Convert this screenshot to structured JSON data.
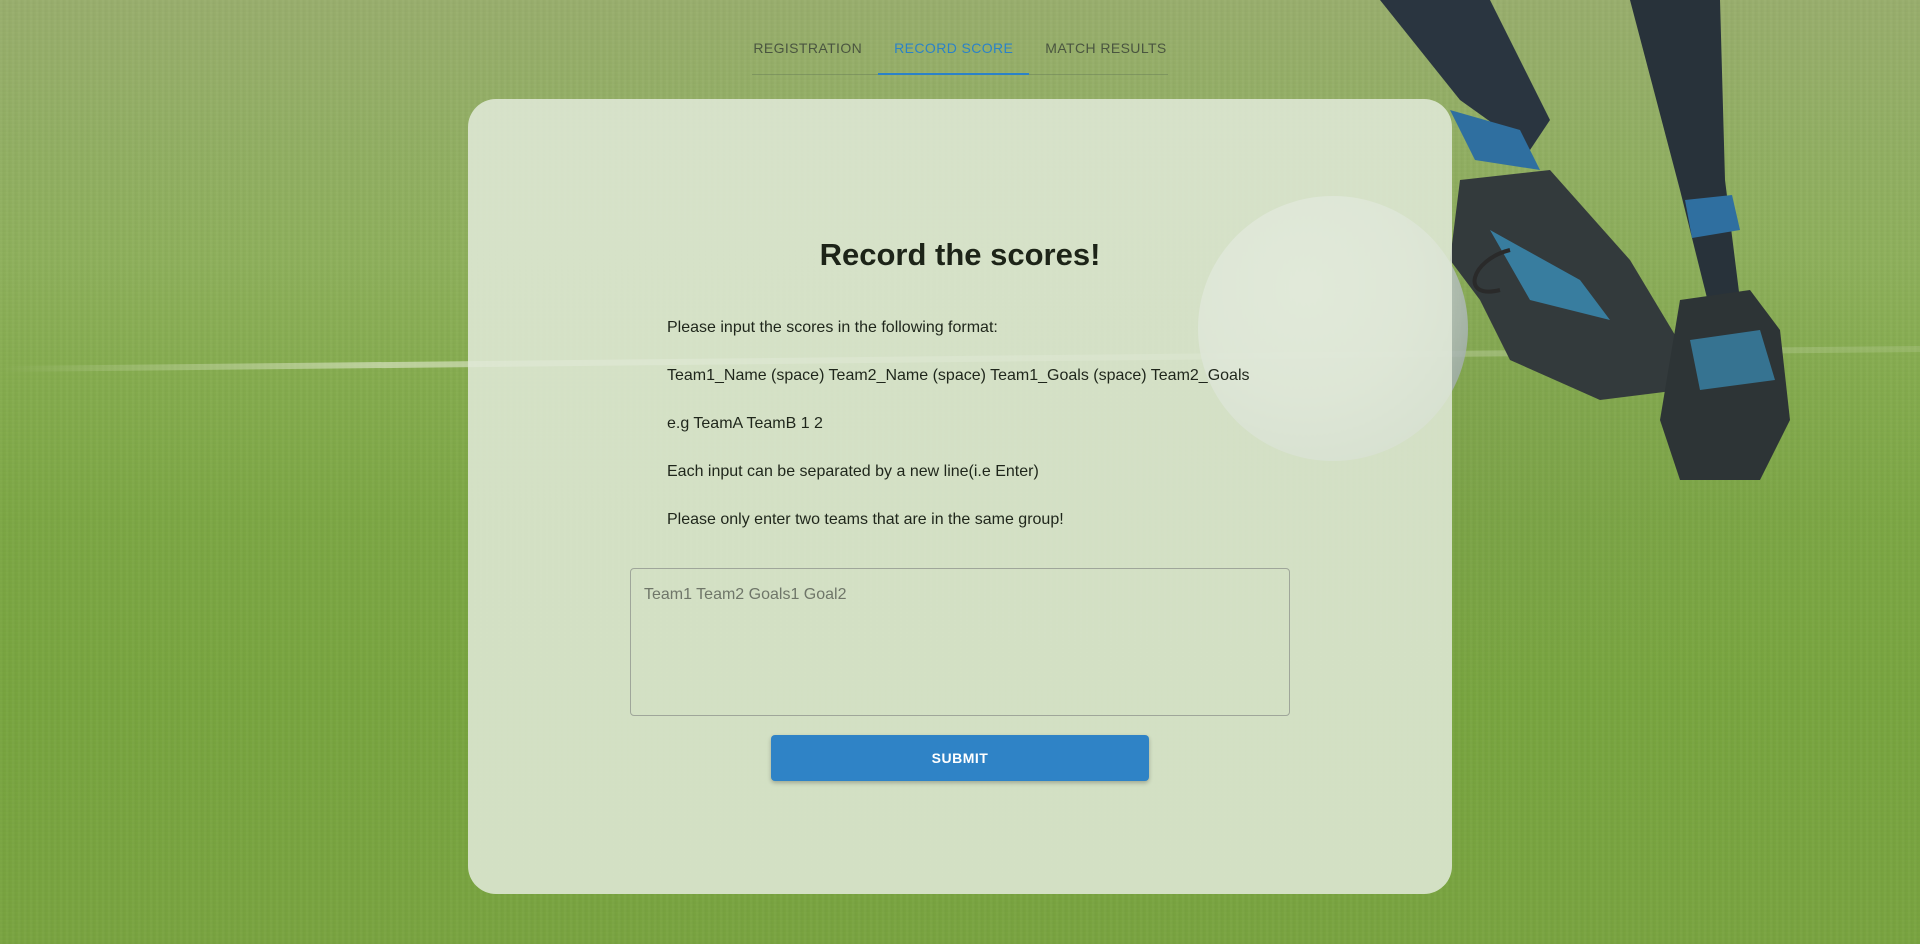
{
  "tabs": [
    {
      "label": "REGISTRATION",
      "active": false
    },
    {
      "label": "RECORD SCORE",
      "active": true
    },
    {
      "label": "MATCH RESULTS",
      "active": false
    }
  ],
  "colors": {
    "accent": "#2b82c8",
    "button": "#2f83c6",
    "card": "#e2eada",
    "title": "#1d2418"
  },
  "form": {
    "title": "Record the scores!",
    "instructions": [
      "Please input the scores in the following format:",
      "Team1_Name (space) Team2_Name (space) Team1_Goals (space) Team2_Goals",
      "e.g TeamA TeamB 1 2",
      "Each input can be separated by a new line(i.e Enter)",
      "Please only enter two teams that are in the same group!"
    ],
    "input_value": "",
    "input_placeholder": "Team1 Team2 Goals1 Goal2",
    "submit_label": "SUBMIT"
  }
}
